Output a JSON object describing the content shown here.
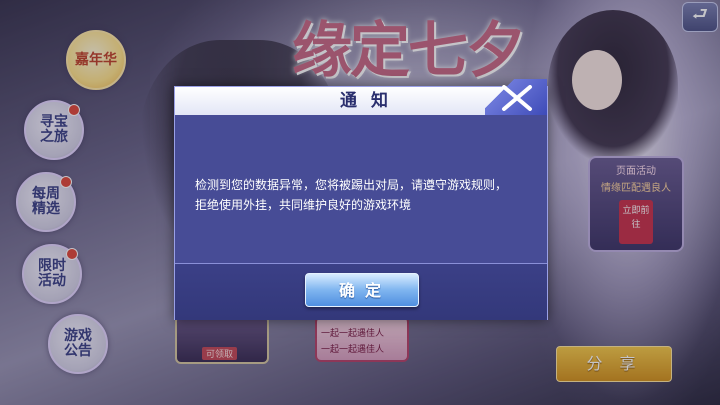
{
  "background": {
    "banner_title": "缘定七夕",
    "card_left_tag": "可领取",
    "card_mid_line1": "一起一起遇佳人",
    "card_mid_line2": "一起一起遇佳人",
    "event_line1": "页面活动",
    "event_line2": "情缘匹配遇良人",
    "event_stamp": "立即前往",
    "share_label": "分 享"
  },
  "sidebar": {
    "items": [
      {
        "label": "嘉年华",
        "badge": false
      },
      {
        "label": "寻宝之旅",
        "badge": true
      },
      {
        "label": "每周精选",
        "badge": true
      },
      {
        "label": "限时活动",
        "badge": true
      },
      {
        "label": "游戏公告",
        "badge": false
      }
    ]
  },
  "dialog": {
    "title": "通知",
    "message": "检测到您的数据异常，您将被踢出对局，请遵守游戏规则，拒绝使用外挂，共同维护良好的游戏环境",
    "confirm_label": "确定"
  },
  "icons": {
    "close": "close-x-icon",
    "back": "return-arrow-icon"
  },
  "colors": {
    "dialog_bg": "#474c96",
    "confirm_button": "#7fb5f0",
    "share_button": "#e6ad34",
    "badge": "#e14a3c"
  }
}
